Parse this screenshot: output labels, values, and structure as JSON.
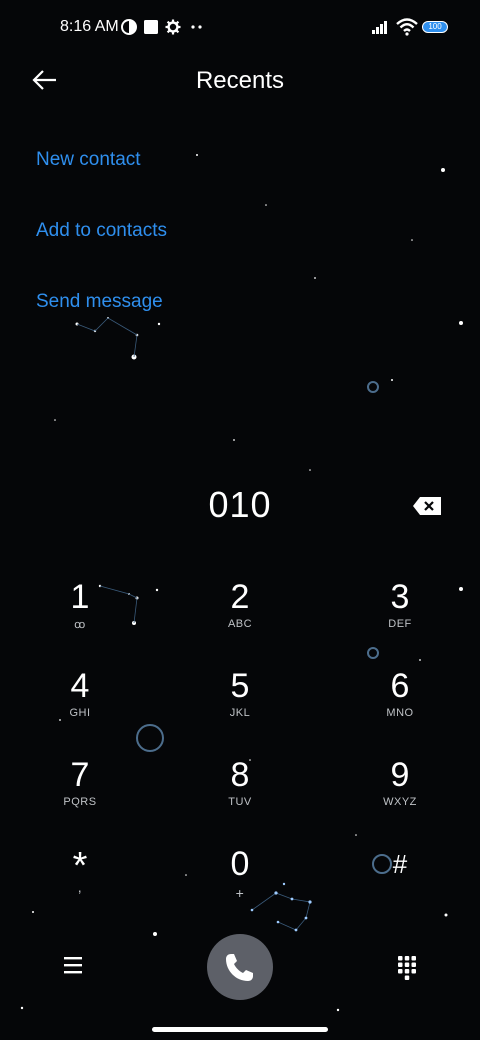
{
  "status_bar": {
    "time": "8:16 AM",
    "icons": [
      "vpn-key-icon",
      "notification-square-icon",
      "settings-gear-icon",
      "more-dots-icon",
      "signal-icon",
      "wifi-icon",
      "battery-icon"
    ],
    "battery_text": "100"
  },
  "header": {
    "title": "Recents",
    "back_icon": "back-arrow-icon"
  },
  "actions": [
    {
      "label": "New contact"
    },
    {
      "label": "Add to contacts"
    },
    {
      "label": "Send message"
    }
  ],
  "dialer": {
    "number": "010",
    "backspace_icon": "backspace-icon",
    "keys": [
      {
        "digit": "1",
        "sub": "ꝏ",
        "sub_icon": "voicemail-icon"
      },
      {
        "digit": "2",
        "sub": "ABC"
      },
      {
        "digit": "3",
        "sub": "DEF"
      },
      {
        "digit": "4",
        "sub": "GHI"
      },
      {
        "digit": "5",
        "sub": "JKL"
      },
      {
        "digit": "6",
        "sub": "MNO"
      },
      {
        "digit": "7",
        "sub": "PQRS"
      },
      {
        "digit": "8",
        "sub": "TUV"
      },
      {
        "digit": "9",
        "sub": "WXYZ"
      },
      {
        "digit": "*",
        "sub": ","
      },
      {
        "digit": "0",
        "sub": "+"
      },
      {
        "digit": "#",
        "sub": ""
      }
    ]
  },
  "bottom_bar": {
    "menu_icon": "menu-icon",
    "call_icon": "phone-icon",
    "keypad_icon": "dialpad-icon"
  },
  "colors": {
    "background": "#050608",
    "accent": "#2f8fee",
    "call_button": "#5d6068"
  }
}
